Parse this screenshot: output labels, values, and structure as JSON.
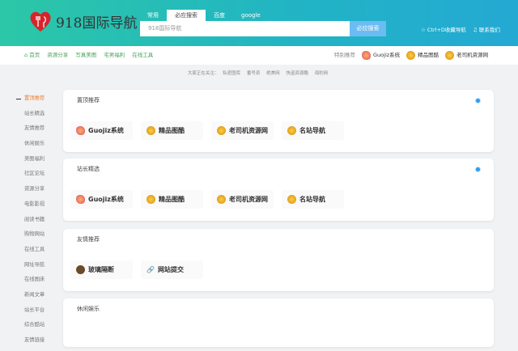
{
  "header": {
    "logo_text": "918国际导航",
    "tabs": [
      "常用",
      "必应搜索",
      "百度",
      "google"
    ],
    "search_placeholder": "918国际导航",
    "search_button": "必应搜索",
    "links": [
      "Ctrl+D收藏导航",
      "联系我们"
    ]
  },
  "nav": {
    "items": [
      "首页",
      "资源分享",
      "写真美图",
      "宅男福利",
      "在线工具"
    ],
    "featured_label": "特别推荐",
    "featured": [
      "Guojiz系统",
      "精品图酷",
      "老司机资源网"
    ]
  },
  "notice": {
    "label": "大家正在关注：",
    "items": [
      "私密图库",
      "番号资",
      "绝美网",
      "快盗资源酷",
      "海豹网"
    ]
  },
  "sidebar": [
    "置顶推荐",
    "站长精选",
    "友情推荐",
    "休闲娱乐",
    "美图福利",
    "社区论坛",
    "资源分享",
    "电影影视",
    "阅读书籍",
    "购物网站",
    "在线工具",
    "网址导航",
    "在线图床",
    "新闻文章",
    "站长平台",
    "综合酷站",
    "友情链接"
  ],
  "cards": [
    {
      "title": "置顶推荐",
      "items": [
        "Guojiz系统",
        "精品图酷",
        "老司机资源网",
        "名站导航"
      ]
    },
    {
      "title": "站长精选",
      "items": [
        "Guojiz系统",
        "精品图酷",
        "老司机资源网",
        "名站导航"
      ]
    },
    {
      "title": "友情推荐",
      "items": [
        "玻璃隔断",
        "网站提交"
      ]
    },
    {
      "title": "休闲娱乐",
      "items": []
    }
  ]
}
